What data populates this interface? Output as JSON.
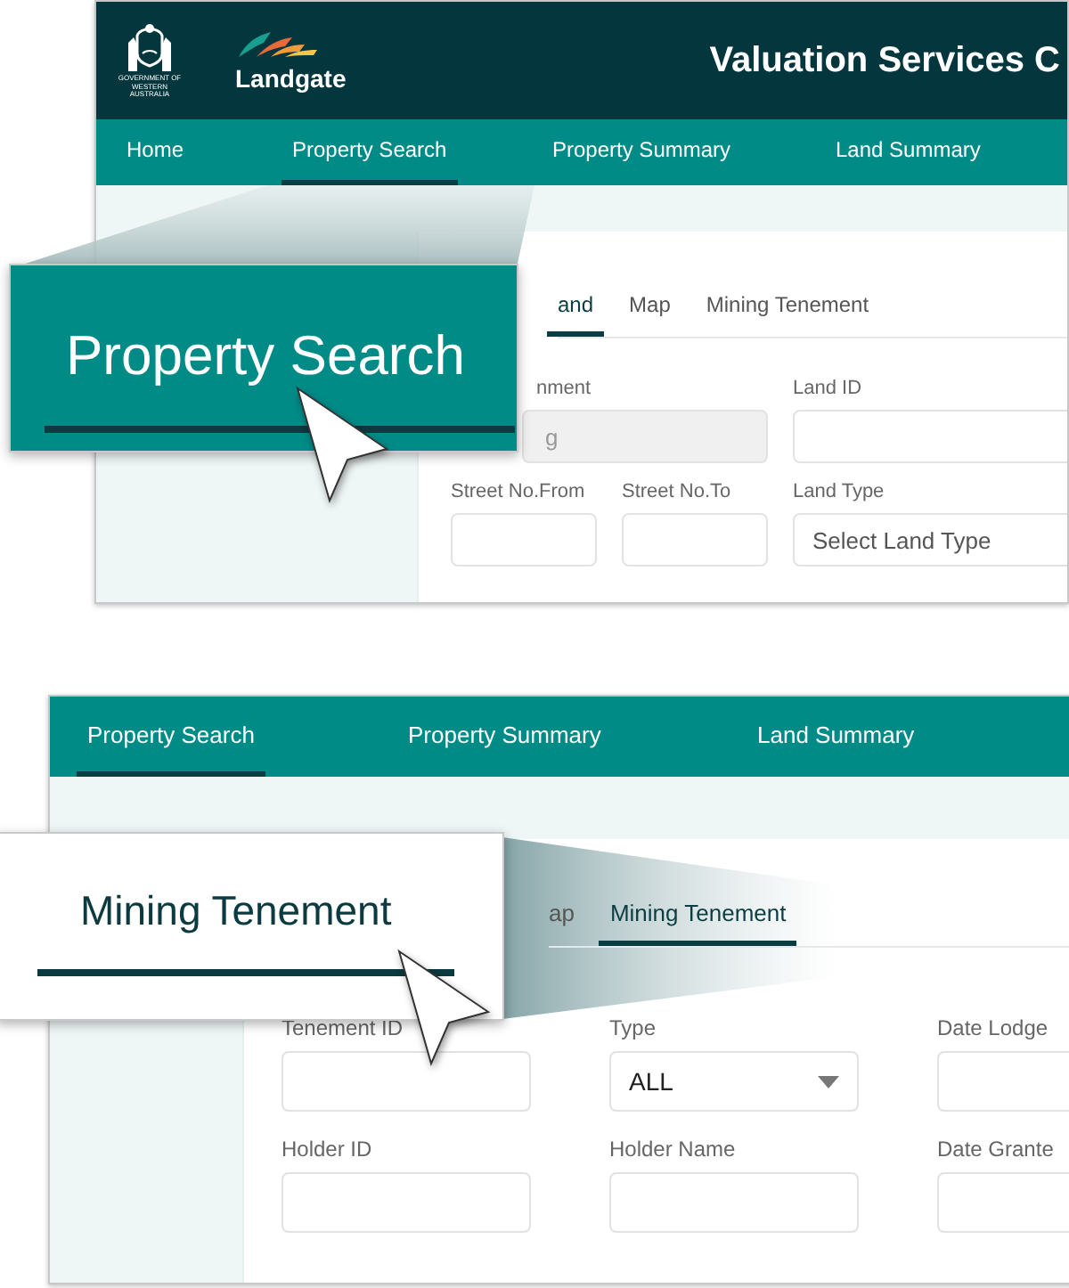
{
  "top_screen": {
    "header": {
      "crest_caption": "GOVERNMENT OF WESTERN AUSTRALIA",
      "logo_text": "Landgate",
      "title": "Valuation Services C"
    },
    "nav": [
      {
        "label": "Home",
        "selected": false
      },
      {
        "label": "Property Search",
        "selected": true
      },
      {
        "label": "Property Summary",
        "selected": false
      },
      {
        "label": "Land Summary",
        "selected": false
      }
    ],
    "tabs": [
      {
        "label": "and",
        "selected": true
      },
      {
        "label": "Map",
        "selected": false
      },
      {
        "label": "Mining Tenement",
        "selected": false
      }
    ],
    "field_rows": [
      [
        {
          "kind": "disabled",
          "label": "nment",
          "value": "g"
        },
        {
          "kind": "text",
          "label": "Land ID"
        }
      ],
      [
        {
          "kind": "text",
          "label": "Street No.From"
        },
        {
          "kind": "text",
          "label": "Street No.To"
        },
        {
          "kind": "select",
          "label": "Land Type",
          "placeholder": "Select Land Type"
        }
      ]
    ]
  },
  "top_callout": {
    "label": "Property Search"
  },
  "bottom_screen": {
    "nav": [
      {
        "label": "Property Search",
        "selected": true
      },
      {
        "label": "Property Summary",
        "selected": false
      },
      {
        "label": "Land Summary",
        "selected": false
      }
    ],
    "tabs": [
      {
        "label": "ap",
        "selected": false
      },
      {
        "label": "Mining Tenement",
        "selected": true
      }
    ],
    "field_rows": [
      [
        {
          "kind": "text",
          "label": "Tenement ID"
        },
        {
          "kind": "select",
          "label": "Type",
          "value": "ALL"
        },
        {
          "kind": "text",
          "label": "Date Lodge"
        }
      ],
      [
        {
          "kind": "text",
          "label": "Holder ID"
        },
        {
          "kind": "text",
          "label": "Holder Name"
        },
        {
          "kind": "text",
          "label": "Date Grante"
        }
      ]
    ]
  },
  "bottom_callout": {
    "label": "Mining Tenement"
  }
}
